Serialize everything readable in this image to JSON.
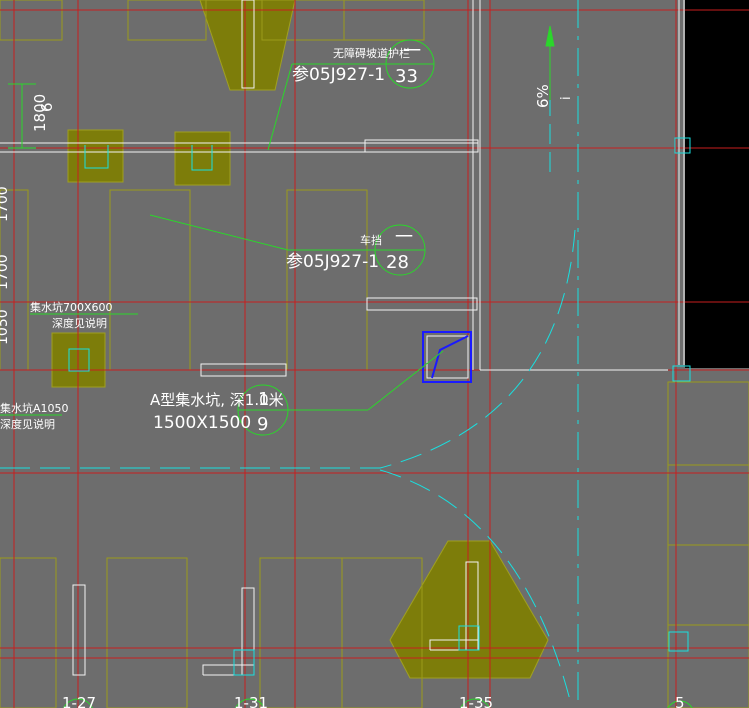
{
  "drawing": {
    "colors": {
      "background": "#6d6d6d",
      "axis_red": "#c81e1e",
      "green": "#2bd62b",
      "cyan": "#19e0e0",
      "olive": "#8a8a00",
      "olive_line": "#9a9a1a",
      "white": "#f2f2f2",
      "blue": "#1a1aff",
      "black": "#000000"
    },
    "callouts": {
      "guardrail_label": "无障碍坡道护栏",
      "guardrail_ref": "参05J927-1",
      "guardrail_top": "一",
      "guardrail_num": "33",
      "wheel_stop_label": "车挡",
      "wheel_stop_ref": "参05J927-1",
      "wheel_stop_top": "一",
      "wheel_stop_num": "28",
      "sump_label": "A型集水坑, 深1.0米",
      "sump_size": "1500X1500",
      "sump_top": "1",
      "sump_num": "9"
    },
    "notes": {
      "dim_1800": "1800",
      "dim_6": "6",
      "slope": "6%",
      "slope_arrow": "i",
      "left_dim_top": "1700",
      "left_dim_mid": "1700",
      "left_dim_low": "1050",
      "pit_label_1": "集水坑700X600",
      "pit_label_1b": "深度见说明",
      "pit_label_2": "集水坑A1050",
      "pit_label_2b": "深度见说明"
    },
    "axes": {
      "a1": "1-27",
      "a2": "1-31",
      "a3": "1-35",
      "a4": "5"
    }
  }
}
